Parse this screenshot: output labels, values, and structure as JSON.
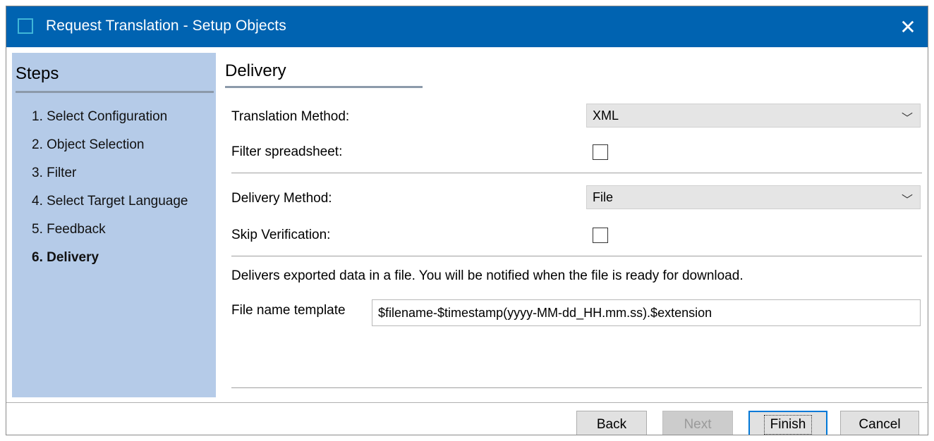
{
  "window": {
    "title": "Request Translation - Setup Objects",
    "close_glyph": "✕"
  },
  "steps": {
    "title": "Steps",
    "items": [
      {
        "label": "1. Select Configuration"
      },
      {
        "label": "2. Object Selection"
      },
      {
        "label": "3. Filter"
      },
      {
        "label": "4. Select Target Language"
      },
      {
        "label": "5. Feedback"
      },
      {
        "label": "6. Delivery"
      }
    ]
  },
  "delivery": {
    "title": "Delivery",
    "translation_method_label": "Translation Method:",
    "translation_method_value": "XML",
    "filter_spreadsheet_label": "Filter spreadsheet:",
    "delivery_method_label": "Delivery Method:",
    "delivery_method_value": "File",
    "skip_verification_label": "Skip Verification:",
    "description": "Delivers exported data in a file. You will be notified when the file is ready for download.",
    "file_name_template_label": "File name template",
    "file_name_template_value": "$filename-$timestamp(yyyy-MM-dd_HH.mm.ss).$extension"
  },
  "buttons": {
    "back": "Back",
    "next": "Next",
    "finish": "Finish",
    "cancel": "Cancel"
  },
  "colors": {
    "titlebar": "#0063b1",
    "steps_panel": "#b5cbe8"
  }
}
